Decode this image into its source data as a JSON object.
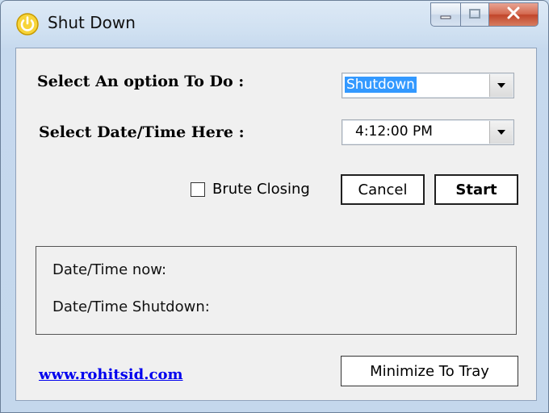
{
  "window": {
    "title": "Shut Down",
    "icon": "power-icon",
    "controls": [
      "minimize-icon",
      "maximize-icon",
      "close-icon"
    ]
  },
  "form": {
    "option_label": "Select An option To Do :",
    "option_value": "Shutdown",
    "datetime_label": "Select Date/Time Here :",
    "datetime_value": "4:12:00 PM"
  },
  "actions": {
    "brute_closing_label": "Brute Closing",
    "brute_closing_checked": false,
    "cancel_label": "Cancel",
    "start_label": "Start"
  },
  "status": {
    "now_label": "Date/Time now:",
    "shutdown_label": "Date/Time Shutdown:"
  },
  "footer": {
    "link_text": "www.rohitsid.com",
    "minimize_label": "Minimize To Tray"
  },
  "colors": {
    "accent_icon": "#f2c200",
    "selection": "#3399ff",
    "link": "#0000ee",
    "close_button": "#c1452a"
  }
}
